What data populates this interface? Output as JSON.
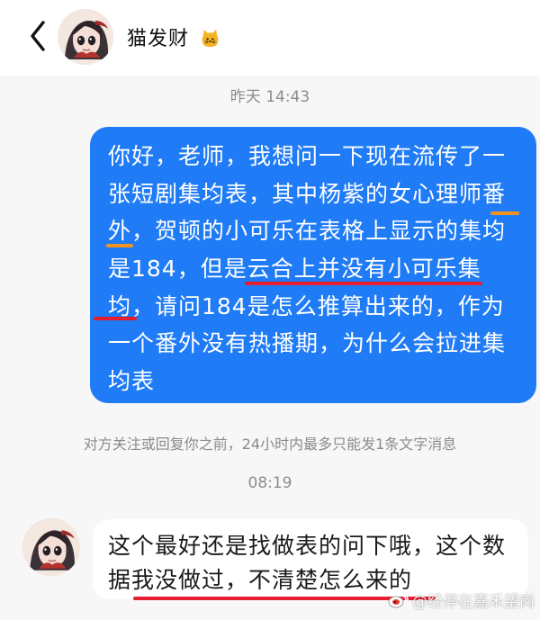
{
  "header": {
    "back_icon": "chevron-left-icon",
    "avatar_icon": "anime-girl-avatar",
    "name": "猫发财",
    "emoji_icon": "cat-face-icon"
  },
  "messages": {
    "time_1": "昨天 14:43",
    "outgoing_lines": [
      "你好，老师，我想问一下现在流传了一",
      "张短剧集均表，其中杨紫的女心理师番",
      "外，贺顿的小可乐在表格上显示的集均",
      "是184，但是云合上并没有小可乐集",
      "均，请问184是怎么推算出来的，作为",
      "一个番外没有热播期，为什么会拉进集",
      "均表"
    ],
    "note": "对方关注或回复你之前，24小时内最多只能发1条文字消息",
    "time_2": "08:19",
    "incoming_lines": [
      "这个最好还是找做表的问下哦，这个数",
      "据我没做过，不清楚怎么来的"
    ]
  },
  "overlay": {
    "watermark": "@经停在嘉禾望岗",
    "weibo_icon": "weibo-icon"
  },
  "colors": {
    "primary_blue": "#1f7bf6",
    "highlight_red": "#e61d2f",
    "highlight_orange": "#f1931e",
    "text_gray": "#8c8c8c"
  }
}
